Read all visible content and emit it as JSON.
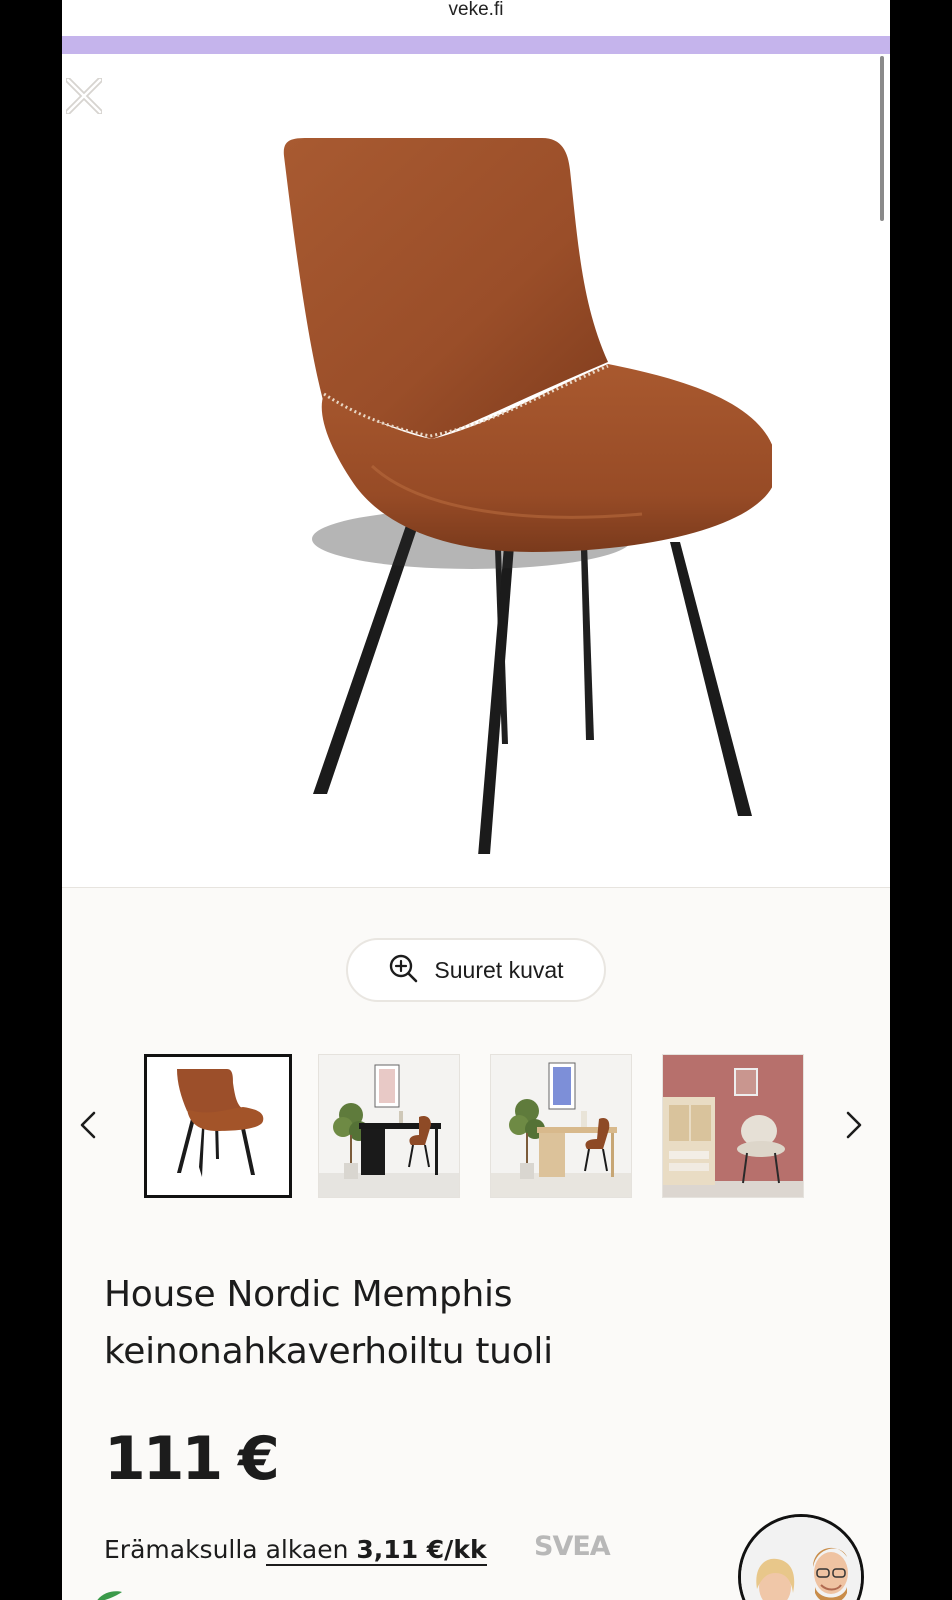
{
  "browser": {
    "url": "veke.fi"
  },
  "gallery": {
    "zoom_label": "Suuret kuvat",
    "thumbnails": [
      {
        "alt": "chair-thumbnail",
        "active": true
      },
      {
        "alt": "desk-room-thumbnail",
        "active": false
      },
      {
        "alt": "oak-desk-room-thumbnail",
        "active": false
      },
      {
        "alt": "pink-room-thumbnail",
        "active": false
      }
    ]
  },
  "product": {
    "title_line1": "House Nordic Memphis",
    "title_line2": "keinonahkaverhoiltu tuoli",
    "price": "111 €",
    "installment_prefix": "Erämaksulla",
    "installment_link": "alkaen",
    "installment_amount": "3,11 €/kk",
    "financing_logo": "SVEA"
  },
  "colors": {
    "accent": "#c5b4ec",
    "leather": "#9c4f2a",
    "background": "#fbfaf8"
  },
  "icons": {
    "close": "close-icon",
    "zoom": "zoom-in-icon",
    "prev": "chevron-left-icon",
    "next": "chevron-right-icon"
  }
}
